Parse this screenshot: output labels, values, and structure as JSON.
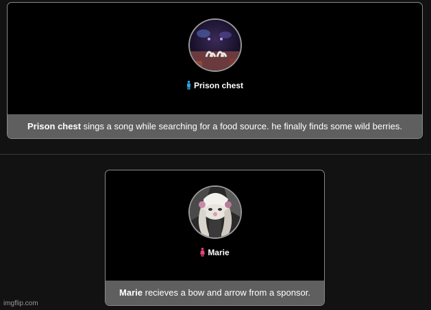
{
  "events": [
    {
      "name": "Prison chest",
      "gender_icon": "male-icon",
      "gender_color": "#2aa6e0",
      "caption_rest": " sings a song while searching for a food source. he finally finds some wild berries."
    },
    {
      "name": "Marie",
      "gender_icon": "female-icon",
      "gender_color": "#e8407a",
      "caption_rest": " recieves a bow and arrow from a sponsor."
    }
  ],
  "watermark": "imgflip.com"
}
